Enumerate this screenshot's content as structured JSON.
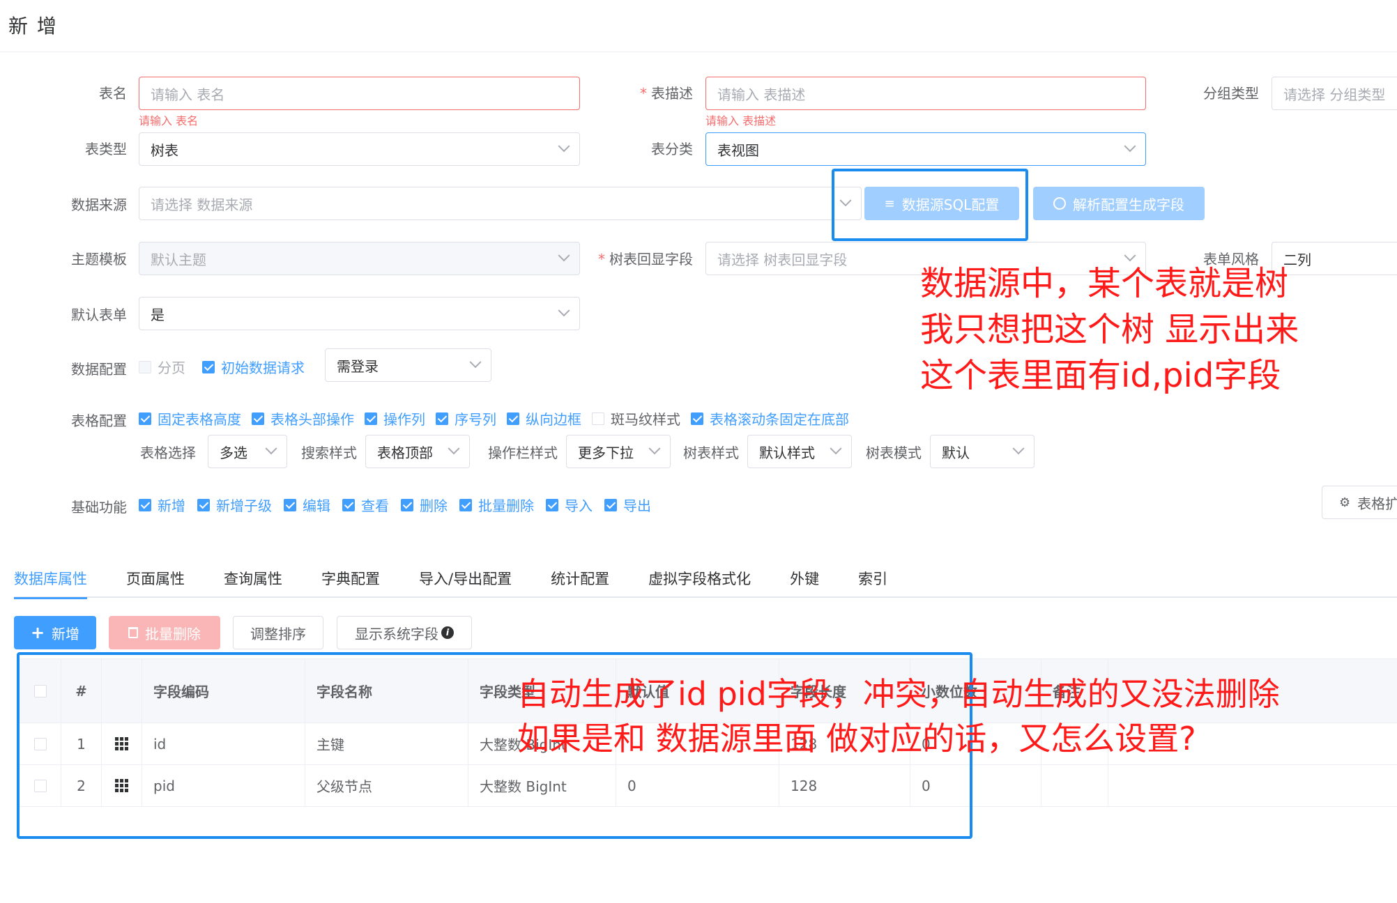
{
  "page": {
    "title": "新 增"
  },
  "form": {
    "table_name": {
      "label": "表名",
      "placeholder": "请输入 表名",
      "error": "请输入 表名"
    },
    "table_desc": {
      "required_mark": "*",
      "label": "表描述",
      "placeholder": "请输入 表描述",
      "error": "请输入 表描述"
    },
    "group_type": {
      "label": "分组类型",
      "placeholder": "请选择 分组类型"
    },
    "table_type": {
      "label": "表类型",
      "value": "树表"
    },
    "table_category": {
      "label": "表分类",
      "value": "表视图"
    },
    "data_source": {
      "label": "数据来源",
      "placeholder": "请选择 数据来源"
    },
    "sql_config_button": "数据源SQL配置",
    "parse_button": "解析配置生成字段",
    "theme_template": {
      "label": "主题模板",
      "placeholder": "默认主题"
    },
    "tree_display_field": {
      "required_mark": "*",
      "label": "树表回显字段",
      "placeholder": "请选择 树表回显字段"
    },
    "form_style": {
      "label": "表单风格",
      "value": "二列"
    },
    "default_form": {
      "label": "默认表单",
      "value": "是"
    },
    "data_config": {
      "label": "数据配置",
      "pagination": {
        "label": "分页",
        "checked": false,
        "disabled": true
      },
      "init_request": {
        "label": "初始数据请求",
        "checked": true
      },
      "login_select": "需登录"
    },
    "table_config": {
      "label": "表格配置",
      "options": [
        {
          "label": "固定表格高度",
          "checked": true
        },
        {
          "label": "表格头部操作",
          "checked": true
        },
        {
          "label": "操作列",
          "checked": true
        },
        {
          "label": "序号列",
          "checked": true
        },
        {
          "label": "纵向边框",
          "checked": true
        },
        {
          "label": "斑马纹样式",
          "checked": false
        },
        {
          "label": "表格滚动条固定在底部",
          "checked": true
        }
      ],
      "table_select": {
        "label": "表格选择",
        "value": "多选"
      },
      "search_style": {
        "label": "搜索样式",
        "value": "表格顶部"
      },
      "action_style": {
        "label": "操作栏样式",
        "value": "更多下拉"
      },
      "tree_style": {
        "label": "树表样式",
        "value": "默认样式"
      },
      "tree_mode": {
        "label": "树表模式",
        "value": "默认"
      }
    },
    "basic_functions": {
      "label": "基础功能",
      "options": [
        {
          "label": "新增",
          "checked": true
        },
        {
          "label": "新增子级",
          "checked": true
        },
        {
          "label": "编辑",
          "checked": true
        },
        {
          "label": "查看",
          "checked": true
        },
        {
          "label": "删除",
          "checked": true
        },
        {
          "label": "批量删除",
          "checked": true
        },
        {
          "label": "导入",
          "checked": true
        },
        {
          "label": "导出",
          "checked": true
        }
      ],
      "table_ext_button": "表格扩"
    }
  },
  "tabs": [
    "数据库属性",
    "页面属性",
    "查询属性",
    "字典配置",
    "导入/导出配置",
    "统计配置",
    "虚拟字段格式化",
    "外键",
    "索引"
  ],
  "toolbar": {
    "add": "新增",
    "batch_delete": "批量删除",
    "sort": "调整排序",
    "show_system": "显示系统字段"
  },
  "grid": {
    "columns": [
      "#",
      "字段编码",
      "字段名称",
      "字段类型",
      "默认值",
      "字段长度",
      "小数位数",
      "备注"
    ],
    "rows": [
      {
        "index": "1",
        "code": "id",
        "name": "主键",
        "type": "大整数 BigInt",
        "default": "",
        "length": "128",
        "decimals": "0",
        "remark": ""
      },
      {
        "index": "2",
        "code": "pid",
        "name": "父级节点",
        "type": "大整数 BigInt",
        "default": "0",
        "length": "128",
        "decimals": "0",
        "remark": ""
      }
    ]
  },
  "annotations": {
    "note1": [
      "数据源中，某个表就是树",
      "我只想把这个树 显示出来",
      "这个表里面有id,pid字段"
    ],
    "note2": [
      "自动生成了id pid字段，冲突，自动生成的又没法删除",
      "如果是和 数据源里面 做对应的话，又怎么设置?"
    ]
  },
  "colors": {
    "primary": "#409eff",
    "danger": "#f56c6c",
    "annotation_red": "#ff1a1a",
    "annotation_blue": "#1a8cf0"
  }
}
